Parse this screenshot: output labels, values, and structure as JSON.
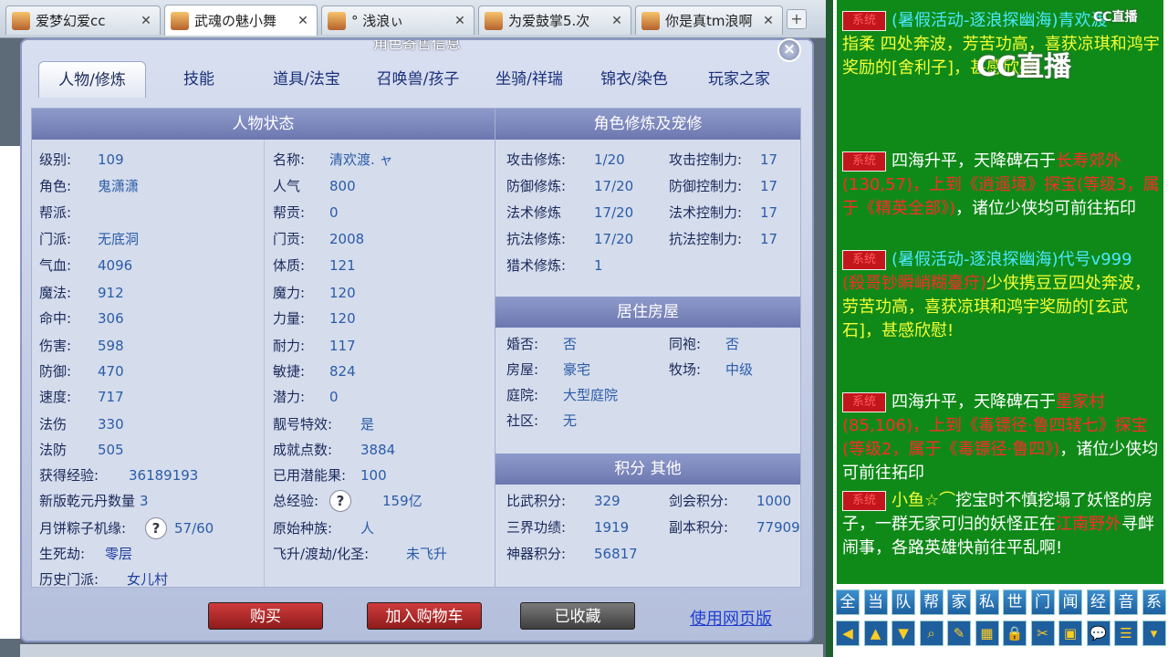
{
  "browser_tabs": [
    {
      "label": "爱梦幻爱cc"
    },
    {
      "label": "武魂の魅小舞",
      "active": true
    },
    {
      "label": "° 浅浪ぃ"
    },
    {
      "label": "为爱鼓掌5.次"
    },
    {
      "label": "你是真tm浪啊"
    }
  ],
  "dialog": {
    "title": "角色寄售信息",
    "close": "×",
    "tabs": [
      "人物/修炼",
      "技能",
      "道具/法宝",
      "召唤兽/孩子",
      "坐骑/祥瑞",
      "锦衣/染色",
      "玩家之家"
    ],
    "status_header": "人物状态",
    "left_col": [
      {
        "label": "级别:",
        "value": "109"
      },
      {
        "label": "角色:",
        "value": "鬼潇潇"
      },
      {
        "label": "帮派:",
        "value": ""
      },
      {
        "label": "门派:",
        "value": "无底洞"
      },
      {
        "label": "气血:",
        "value": "4096"
      },
      {
        "label": "魔法:",
        "value": "912"
      },
      {
        "label": "命中:",
        "value": "306"
      },
      {
        "label": "伤害:",
        "value": "598"
      },
      {
        "label": "防御:",
        "value": "470"
      },
      {
        "label": "速度:",
        "value": "717"
      },
      {
        "label": "法伤",
        "value": "330"
      },
      {
        "label": "法防",
        "value": "505"
      },
      {
        "label": "获得经验:",
        "value": "36189193"
      },
      {
        "label": "新版乾元丹数量",
        "value": "3"
      },
      {
        "label": "月饼粽子机缘:",
        "value": "57/60"
      },
      {
        "label": "生死劫:",
        "value": "零层"
      },
      {
        "label": "历史门派:",
        "value": "女儿村"
      }
    ],
    "mid_col": [
      {
        "label": "名称:",
        "value": "清欢渡. ャ"
      },
      {
        "label": "人气",
        "value": "800"
      },
      {
        "label": "帮贡:",
        "value": "0"
      },
      {
        "label": "门贡:",
        "value": "2008"
      },
      {
        "label": "体质:",
        "value": "121"
      },
      {
        "label": "魔力:",
        "value": "120"
      },
      {
        "label": "力量:",
        "value": "120"
      },
      {
        "label": "耐力:",
        "value": "117"
      },
      {
        "label": "敏捷:",
        "value": "824"
      },
      {
        "label": "潜力:",
        "value": "0"
      },
      {
        "label": "靓号特效:",
        "value": "是"
      },
      {
        "label": "成就点数:",
        "value": "3884"
      },
      {
        "label": "已用潜能果:",
        "value": "100"
      },
      {
        "label": "总经验:",
        "value": "159亿"
      },
      {
        "label": "原始种族:",
        "value": "人"
      },
      {
        "label": "飞升/渡劫/化圣:",
        "value": "未飞升"
      }
    ],
    "qmark": "?",
    "cultivation_header": "角色修炼及宠修",
    "cultivation": [
      {
        "label": "攻击修炼:",
        "value": "1/20",
        "label2": "攻击控制力:",
        "value2": "17"
      },
      {
        "label": "防御修炼:",
        "value": "17/20",
        "label2": "防御控制力:",
        "value2": "17"
      },
      {
        "label": "法术修炼",
        "value": "17/20",
        "label2": "法术控制力:",
        "value2": "17"
      },
      {
        "label": "抗法修炼:",
        "value": "17/20",
        "label2": "抗法控制力:",
        "value2": "17"
      },
      {
        "label": "猎术修炼:",
        "value": "1",
        "label2": "",
        "value2": ""
      }
    ],
    "house_header": "居住房屋",
    "house": [
      {
        "label": "婚否:",
        "value": "否",
        "label2": "同袍:",
        "value2": "否"
      },
      {
        "label": "房屋:",
        "value": "豪宅",
        "label2": "牧场:",
        "value2": "中级"
      },
      {
        "label": "庭院:",
        "value": "大型庭院",
        "label2": "",
        "value2": ""
      },
      {
        "label": "社区:",
        "value": "无",
        "label2": "",
        "value2": ""
      }
    ],
    "points_header": "积分 其他",
    "points": [
      {
        "label": "比武积分:",
        "value": "329",
        "label2": "剑会积分:",
        "value2": "1000"
      },
      {
        "label": "三界功绩:",
        "value": "1919",
        "label2": "副本积分:",
        "value2": "77909"
      },
      {
        "label": "神器积分:",
        "value": "56817",
        "label2": "",
        "value2": ""
      }
    ],
    "buttons": {
      "buy": "购买",
      "cart": "加入购物车",
      "fav": "已收藏",
      "web": "使用网页版"
    }
  },
  "chat": {
    "logo": "CC直播",
    "logo_small": "CC直播",
    "sys_tag": "系统",
    "messages": [
      {
        "a": "(暑假活动-逐浪探幽海)青欢渡",
        "b": "指柔",
        "c": "四处奔波，芳苦功高，喜获凉琪和鸿宇奖励的[舍利子]，甚感欣慰!"
      },
      {
        "a": "四海升平，天降碑石于",
        "b": "长寿郊外(130,57)，上到《逍遥境》探宝(等级3，属于《精英全部》)",
        "c": "，诸位少侠均可前往拓印"
      },
      {
        "a": "(暑假活动-逐浪探幽海)代号v999",
        "b": "(殺哥钞瞬峭糊臺疛)",
        "c": "少侠携豆豆四处奔波，劳苦功高，喜获凉琪和鸿宇奖励的[玄武石]，甚感欣慰!"
      },
      {
        "a": "四海升平，天降碑石于",
        "b": "墨家村(85,106)，上到《毒镖径·鲁四辖七》探宝(等级2，属于《毒镖径·鲁四》)",
        "c": "，诸位少侠均可前往拓印"
      },
      {
        "a": "小鱼☆⌒",
        "b": "挖宝时不慎挖塌了妖怪的房子，一群无家可归的妖怪正在",
        "c": "江南野外",
        "d": "寻衅闹事，各路英雄快前往平乱啊!"
      }
    ],
    "tabs": [
      "全",
      "当",
      "队",
      "帮",
      "家",
      "私",
      "世",
      "门",
      "闻",
      "经",
      "音",
      "系"
    ],
    "tools": [
      "◀",
      "▲",
      "▼",
      "⌕",
      "✎",
      "▦",
      "🔒",
      "✂",
      "▣",
      "💬",
      "☰",
      "▾"
    ]
  }
}
